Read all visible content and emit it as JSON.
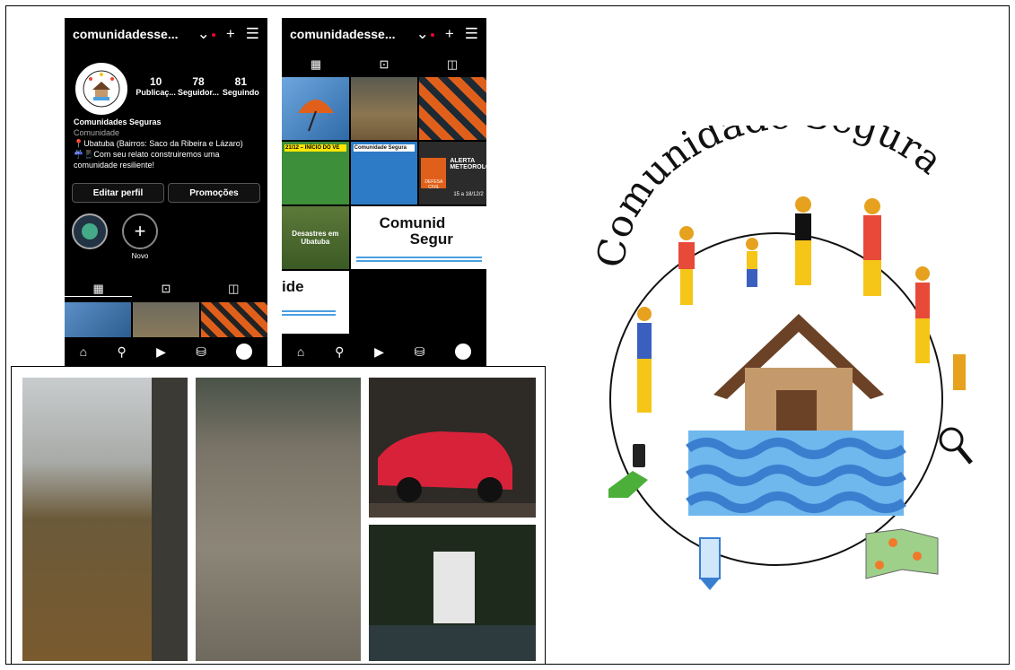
{
  "profile": {
    "username": "comunidadesse...",
    "stats": [
      {
        "num": "10",
        "label": "Publicaç..."
      },
      {
        "num": "78",
        "label": "Seguidor..."
      },
      {
        "num": "81",
        "label": "Seguindo"
      }
    ],
    "name": "Comunidades Seguras",
    "category": "Comunidade",
    "bio_line1": "📍Ubatuba (Bairros: Saco da Ribeira e Lázaro)",
    "bio_line2": "☔📱Com seu relato construiremos uma comunidade resiliente!",
    "edit_button": "Editar perfil",
    "promo_button": "Promoções",
    "highlight_new": "Novo"
  },
  "grid_texts": {
    "start_verao": "21/12 – INÍCIO DO VE",
    "comunidade_segura": "Comunidade Segura",
    "defesa_civil": "DEFESA CIVIL",
    "alerta": "ALERTA METEOROLÓ",
    "alerta_date": "15 a 18/12/2",
    "desastres": "Desastres em Ubatuba",
    "big_title_1": "Comunid",
    "big_title_2": "Segur",
    "big_ide": "ide"
  },
  "logo": {
    "title": "Comunidade Segura"
  },
  "colors": {
    "water": "#4a9fe0",
    "house": "#c49a6c",
    "roof": "#6b4226",
    "red": "#e84a3a",
    "yellow": "#f5c518",
    "blue": "#3a5fbf"
  }
}
